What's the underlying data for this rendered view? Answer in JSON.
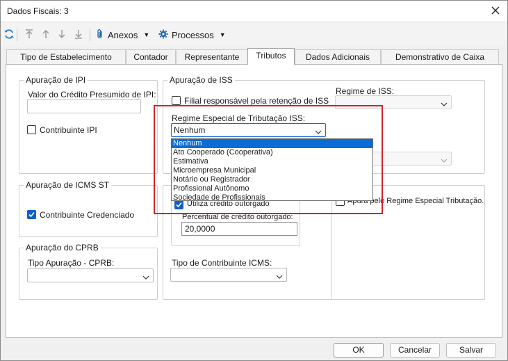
{
  "window": {
    "title": "Dados Fiscais: 3"
  },
  "toolbar": {
    "refresh_icon": "refresh-icon",
    "anexos_label": "Anexos",
    "processos_label": "Processos"
  },
  "tabs": [
    {
      "label": "Tipo de Estabelecimento"
    },
    {
      "label": "Contador"
    },
    {
      "label": "Representante"
    },
    {
      "label": "Tributos"
    },
    {
      "label": "Dados Adicionais"
    },
    {
      "label": "Demonstrativo de Caixa"
    }
  ],
  "ipi": {
    "group_label": "Apuração de IPI",
    "credit_label": "Valor do Crédito Presumido de IPI:",
    "credit_value": "",
    "contrib_label": "Contribuinte IPI",
    "contrib_checked": false
  },
  "icms_st": {
    "group_label": "Apuração de ICMS ST",
    "cred_label": "Contribuinte Credenciado",
    "cred_checked": true
  },
  "cprb": {
    "group_label": "Apuração do CPRB",
    "tipo_label": "Tipo Apuração - CPRB:",
    "tipo_value": ""
  },
  "iss": {
    "group_label": "Apuração de ISS",
    "filial_label": "Filial responsável pela retenção de ISS",
    "filial_checked": false,
    "regime_iss_label": "Regime de ISS:",
    "regime_iss_value": "",
    "regime_especial_label": "Regime Especial de Tributação ISS:",
    "regime_especial_value": "Nenhum",
    "regime_especial_options": [
      "Nenhum",
      "Ato Cooperado (Cooperativa)",
      "Estimativa",
      "Microempresa Municipal",
      "Notário ou Registrador",
      "Profissional Autônomo",
      "Sociedade de Profissionais"
    ],
    "apura_label": "Apura pelo Regime Especial Tributação."
  },
  "icms": {
    "credito_outorgado_label": "Utiliza crédito outorgado",
    "credito_outorgado_checked": true,
    "percentual_label": "Percentual de crédito outorgado:",
    "percentual_value": "20,0000",
    "tipo_contrib_label": "Tipo de Contribuinte ICMS:",
    "tipo_contrib_value": ""
  },
  "footer": {
    "ok_label": "OK",
    "cancel_label": "Cancelar",
    "save_label": "Salvar"
  },
  "colors": {
    "accent": "#0f5ec9",
    "selection": "#0d6bd6",
    "highlight_box": "#d2232a"
  }
}
